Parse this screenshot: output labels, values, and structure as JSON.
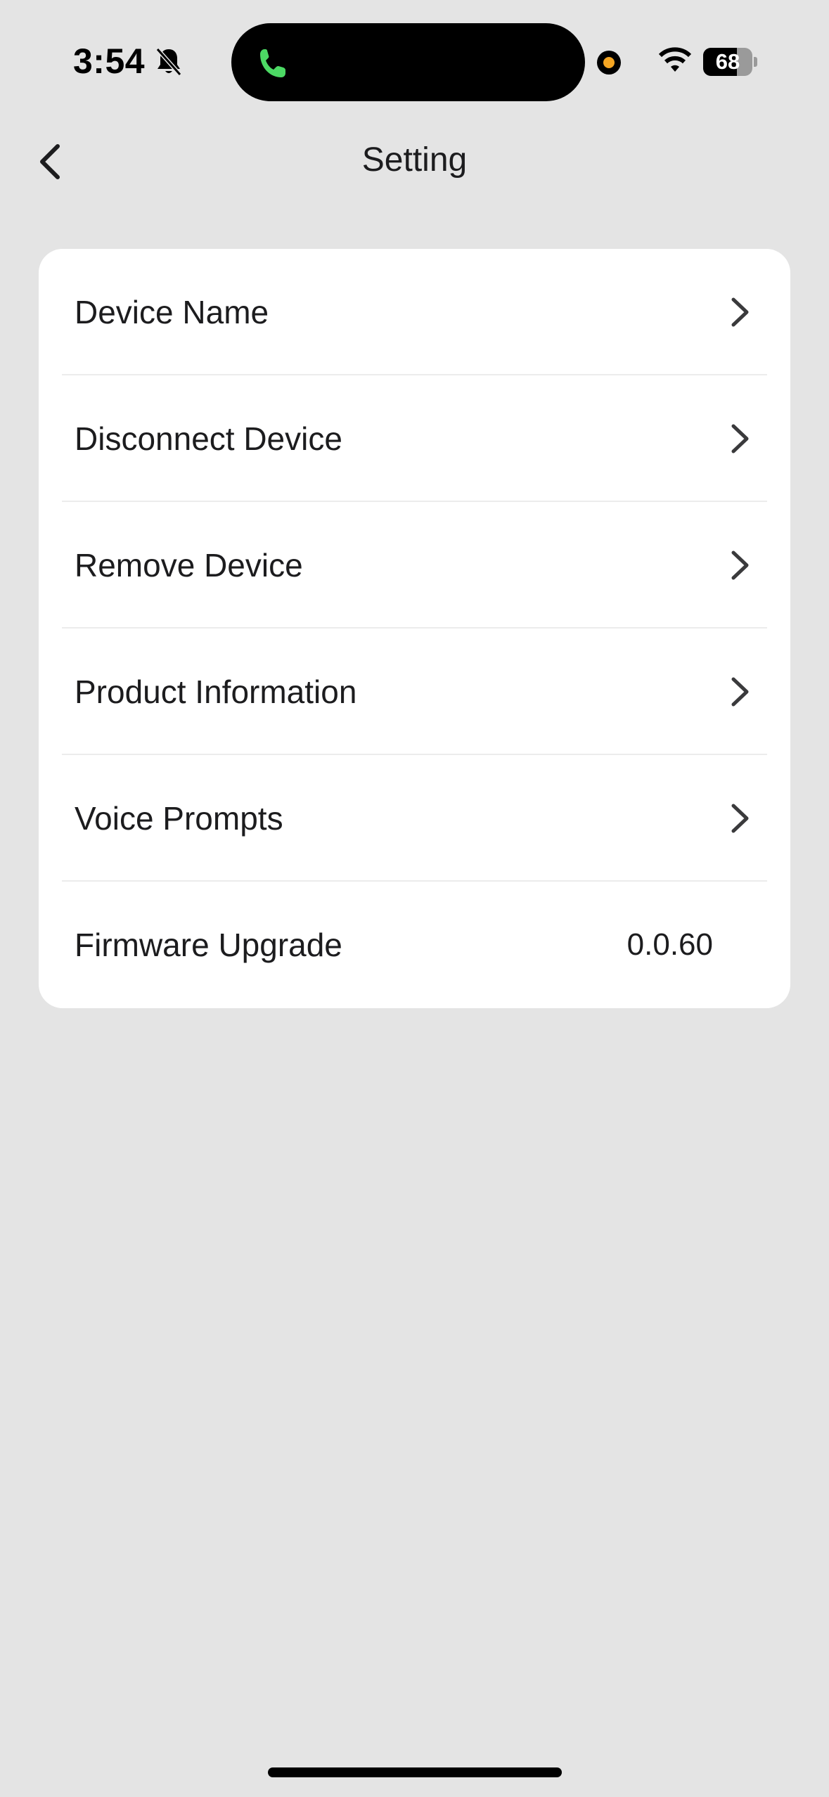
{
  "status_bar": {
    "time": "3:54",
    "battery_level": "68",
    "battery_fraction": 0.68
  },
  "header": {
    "title": "Setting"
  },
  "settings": {
    "items": [
      {
        "label": "Device Name"
      },
      {
        "label": "Disconnect Device"
      },
      {
        "label": "Remove Device"
      },
      {
        "label": "Product Information"
      },
      {
        "label": "Voice Prompts"
      }
    ],
    "firmware": {
      "label": "Firmware Upgrade",
      "value": "0.0.60"
    }
  },
  "colors": {
    "background": "#e4e4e4",
    "card": "#ffffff",
    "call_indicator": "#4cd964",
    "camera_dot": "#f5a623"
  }
}
